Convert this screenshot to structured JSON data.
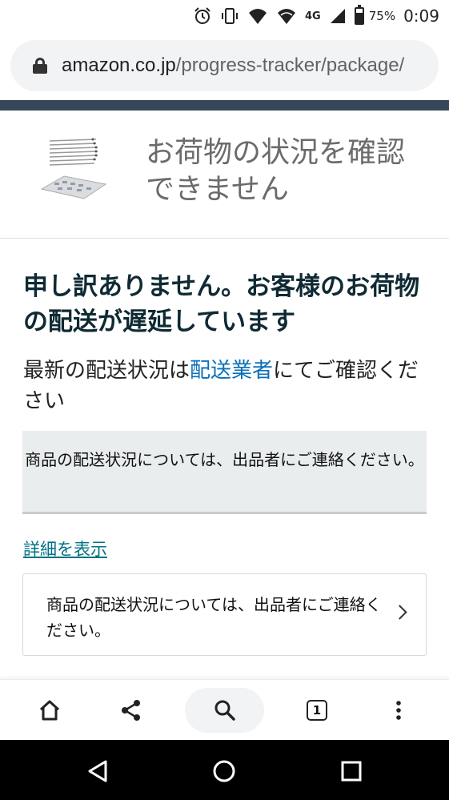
{
  "status_bar": {
    "battery_percent": "75%",
    "network": "4G",
    "time": "0:09",
    "icons": [
      "alarm-icon",
      "vibrate-icon",
      "wifi-calling-icon",
      "wifi-icon",
      "signal-icon",
      "battery-icon"
    ],
    "battery_level": 0.75
  },
  "browser": {
    "url_domain": "amazon.co.jp",
    "url_path": "/progress-tracker/package/"
  },
  "header": {
    "title": "お荷物の状況を確認できません"
  },
  "main": {
    "headline": "申し訳ありません。お客様のお荷物の配送が遅延しています",
    "subline_before": "最新の配送状況は",
    "subline_link": "配送業者",
    "subline_after": "にてご確認ください",
    "notice": "商品の配送状況については、出品者にご連絡ください。",
    "details_link": "詳細を表示",
    "card_text": "商品の配送状況については、出品者にご連絡ください。"
  },
  "toolbar": {
    "tab_count": "1"
  },
  "colors": {
    "nav_strip": "#37475a",
    "link_blue": "#0a6fb8",
    "teal_link": "#007185",
    "notice_bg": "#e9eded",
    "headline": "#0f2a33"
  }
}
